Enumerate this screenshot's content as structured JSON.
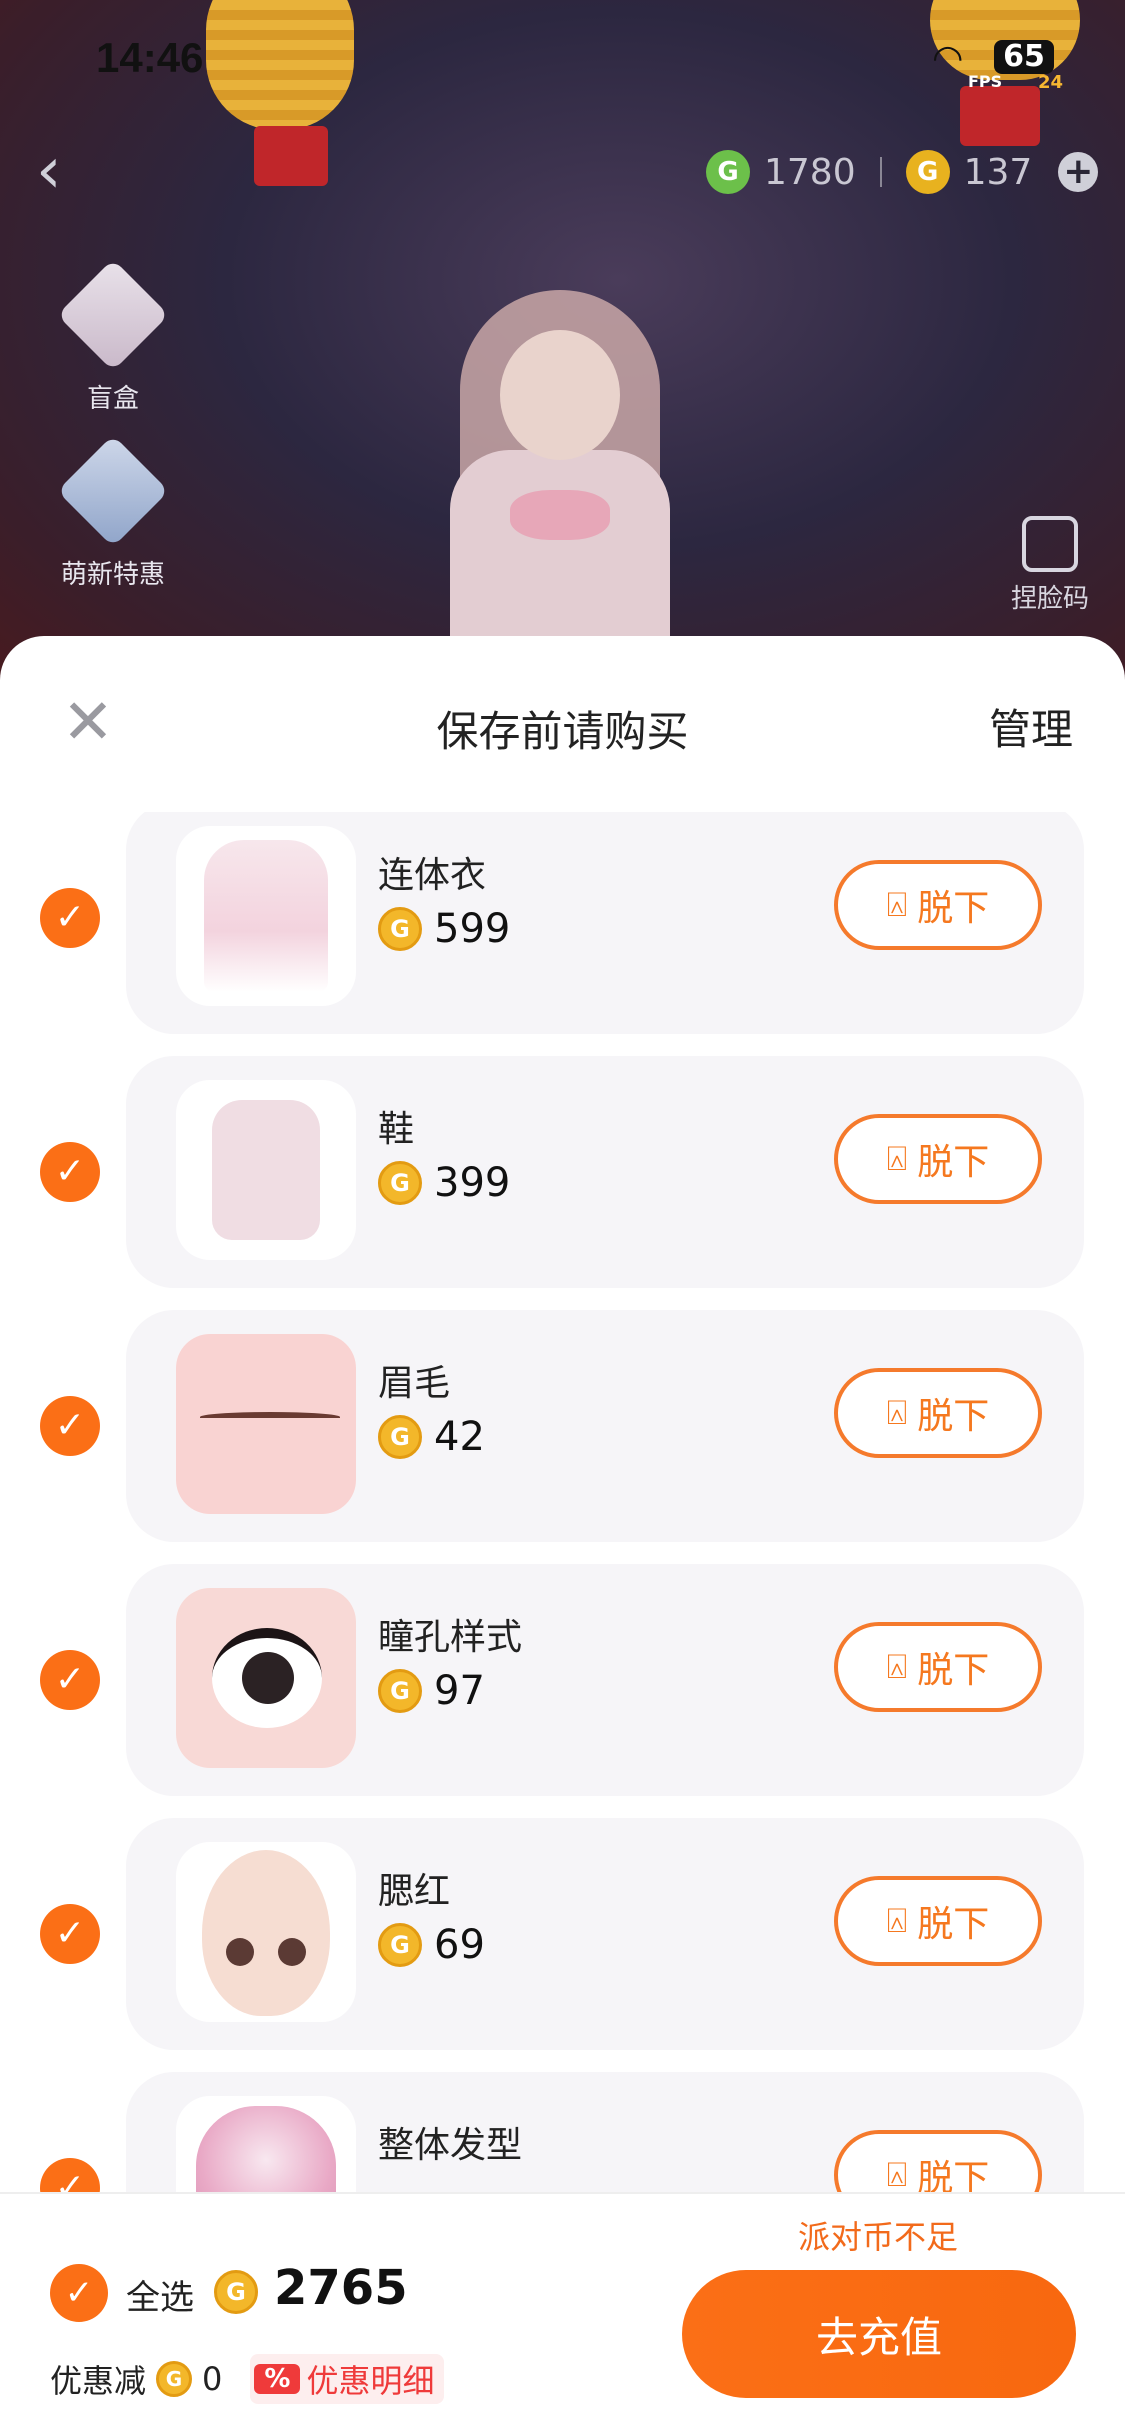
{
  "status_bar": {
    "time": "14:46",
    "battery": "65",
    "fps_label": "FPS",
    "fps_value": "24"
  },
  "currency": {
    "green_coin_icon": "G",
    "green_amount": "1780",
    "gold_coin_icon": "G",
    "gold_amount": "137",
    "add_icon": "+"
  },
  "side_entries": [
    {
      "label": "盲盒",
      "icon": "gift-box-icon"
    },
    {
      "label": "萌新特惠",
      "icon": "outfit-diamond-icon"
    }
  ],
  "face_code": {
    "label": "捏脸码",
    "icon": "edit-square-icon"
  },
  "sheet": {
    "title": "保存前请购买",
    "manage": "管理",
    "close_icon": "✕",
    "items": [
      {
        "name": "连体衣",
        "price": "599",
        "action": "脱下",
        "checked": true,
        "thumb": "dress"
      },
      {
        "name": "鞋",
        "price": "399",
        "action": "脱下",
        "checked": true,
        "thumb": "shoes"
      },
      {
        "name": "眉毛",
        "price": "42",
        "action": "脱下",
        "checked": true,
        "thumb": "brow"
      },
      {
        "name": "瞳孔样式",
        "price": "97",
        "action": "脱下",
        "checked": true,
        "thumb": "eye"
      },
      {
        "name": "腮红",
        "price": "69",
        "action": "脱下",
        "checked": true,
        "thumb": "face"
      },
      {
        "name": "整体发型",
        "price": "",
        "action": "脱下",
        "checked": true,
        "thumb": "hair"
      }
    ]
  },
  "footer": {
    "insufficient": "派对币不足",
    "select_all": "全选",
    "total": "2765",
    "discount_label": "优惠减",
    "discount_amount": "0",
    "discount_badge": "%",
    "discount_detail": "优惠明细",
    "recharge": "去充值"
  },
  "colors": {
    "accent": "#fb6f16",
    "coin_gold": "#f3b72a",
    "discount_red": "#ef3a3a"
  }
}
